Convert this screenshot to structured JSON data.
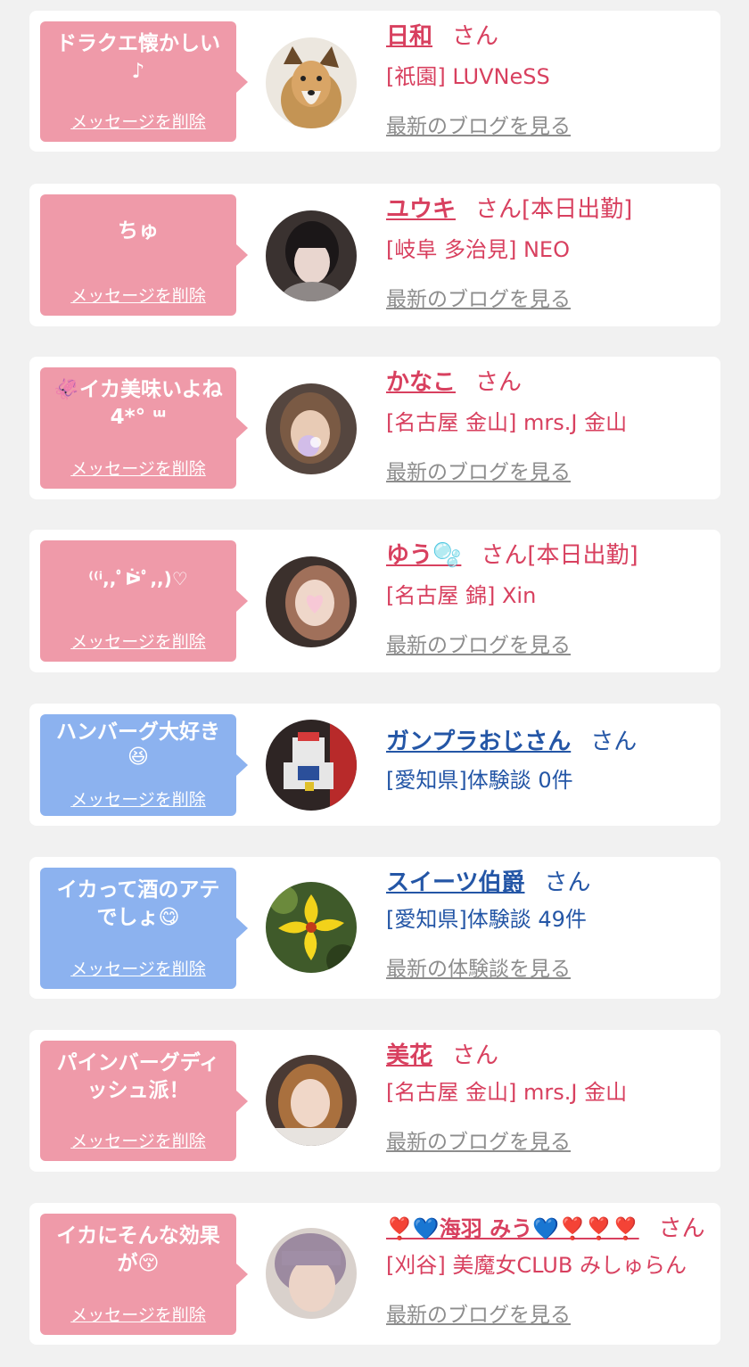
{
  "cards": [
    {
      "message": "ドラクエ懐かしい♪",
      "delete_label": "メッセージを削除",
      "name": "日和",
      "san": "さん",
      "shop": "[祇園] LUVNeSS",
      "blog": "最新のブログを見る",
      "theme": "pink",
      "avatar": "dog-photo"
    },
    {
      "message": "ちゅ",
      "delete_label": "メッセージを削除",
      "name": "ユウキ",
      "san": "さん[本日出勤]",
      "shop": "[岐阜 多治見] NEO",
      "blog": "最新のブログを見る",
      "theme": "pink",
      "avatar": "woman-photo"
    },
    {
      "message": "🦑イカ美味いよね\n4*° ᵚ",
      "delete_label": "メッセージを削除",
      "name": "かなこ",
      "san": "さん",
      "shop": "[名古屋 金山] mrs.J 金山",
      "blog": "最新のブログを見る",
      "theme": "pink",
      "avatar": "woman-photo"
    },
    {
      "message": "⁽⁽ⁱ,,ﾟᐖﾟ,,)♡",
      "delete_label": "メッセージを削除",
      "name": "ゆう🫧",
      "san": "さん[本日出勤]",
      "shop": "[名古屋 錦] Xin",
      "blog": "最新のブログを見る",
      "theme": "pink",
      "avatar": "woman-photo"
    },
    {
      "message": "ハンバーグ大好き\n😆",
      "delete_label": "メッセージを削除",
      "name": "ガンプラおじさん",
      "san": "さん",
      "shop": "[愛知県]体験談 0件",
      "blog": "",
      "theme": "blue",
      "avatar": "robot-photo"
    },
    {
      "message": "イカって酒のアテでしょ😋",
      "delete_label": "メッセージを削除",
      "name": "スイーツ伯爵",
      "san": "さん",
      "shop": "[愛知県]体験談 49件",
      "blog": "最新の体験談を見る",
      "theme": "blue",
      "avatar": "flower-photo"
    },
    {
      "message": "パインバーグディッシュ派！",
      "delete_label": "メッセージを削除",
      "name": "美花",
      "san": "さん",
      "shop": "[名古屋 金山] mrs.J 金山",
      "blog": "最新のブログを見る",
      "theme": "pink",
      "avatar": "woman-photo"
    },
    {
      "message": "イカにそんな効果が😚",
      "delete_label": "メッセージを削除",
      "name": "❣️💙海羽 みう💙❣️❣️❣️",
      "san": "さん",
      "shop": "[刈谷] 美魔女CLUB みしゅらん",
      "blog": "最新のブログを見る",
      "theme": "pink",
      "avatar": "woman-photo"
    }
  ]
}
